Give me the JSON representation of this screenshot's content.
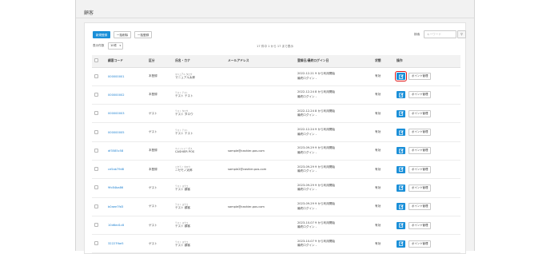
{
  "page": {
    "title": "顧客"
  },
  "toolbar": {
    "new_label": "新規登録",
    "bulk_delete_label": "一括削除",
    "bulk_register_label": "一括登録",
    "display_count_label": "表示件数",
    "display_count_value": "10件",
    "search_label": "検索",
    "search_placeholder": "キーワード"
  },
  "summary": "17 件中 1 から 17 まで表示",
  "table": {
    "headers": [
      "",
      "顧客コード",
      "区分",
      "氏名・カナ",
      "メールアドレス",
      "登録日/最終ログイン日",
      "状態",
      "操作"
    ],
    "edit_label": "編集",
    "points_label": "ポイント管理",
    "rows": [
      {
        "code": "000000001",
        "type": "本登録",
        "kana": "マニュアル タロウ",
        "name": "マニュアル太郎",
        "email": "",
        "login1": "2022-12-21 9 から利用開始",
        "login2": "最終ログイン -",
        "status": "有効"
      },
      {
        "code": "000000002",
        "type": "本登録",
        "kana": "テスト テスト",
        "name": "テスト テスト",
        "email": "",
        "login1": "2022-12-24 8 から利用開始",
        "login2": "最終ログイン -",
        "status": "有効"
      },
      {
        "code": "000000003",
        "type": "ゲスト",
        "kana": "テスト タロウ",
        "name": "テスト タロウ",
        "email": "",
        "login1": "2022-12-24 8 から利用開始",
        "login2": "最終ログイン -",
        "status": "有効"
      },
      {
        "code": "000000005",
        "type": "ゲスト",
        "kana": "テスト テスト",
        "name": "テスト テスト",
        "email": "",
        "login1": "2022-12-24 9 から利用開始",
        "login2": "最終ログイン -",
        "status": "有効"
      },
      {
        "code": "df3585c58",
        "type": "本登録",
        "kana": "キャッシャー ポス",
        "name": "CASHIER POS",
        "email": "sample@cashier-pos.com",
        "login1": "2023-09-29 9 から利用開始",
        "login2": "最終ログイン -",
        "status": "有効"
      },
      {
        "code": "ce5ab79d8",
        "type": "本登録",
        "kana": "ニセモノ タロウ",
        "name": "ニセモノ太郎",
        "email": "sample2@cashier-pos.com",
        "login1": "2023-09-29 9 から利用開始",
        "login2": "最終ログイン -",
        "status": "有効"
      },
      {
        "code": "9fc84ba86",
        "type": "ゲスト",
        "kana": "テスト ヨウコ",
        "name": "テスト 顧客",
        "email": "",
        "login1": "2023-09-29 9 から利用開始",
        "login2": "最終ログイン -",
        "status": "有効"
      },
      {
        "code": "b0aee7fd3",
        "type": "ゲスト",
        "kana": "テスト ヨウコ",
        "name": "テスト 顧客",
        "email": "sample@cashier-pos.com",
        "login1": "2023-09-29 9 から利用開始",
        "login2": "最終ログイン -",
        "status": "有効"
      },
      {
        "code": "10d6ed1c8",
        "type": "ゲスト",
        "kana": "テスト ヨウコ",
        "name": "テスト 顧客",
        "email": "",
        "login1": "2023-10-07 9 から利用開始",
        "login2": "最終ログイン -",
        "status": "有効"
      },
      {
        "code": "32227fbe5",
        "type": "ゲスト",
        "kana": "テスト ヨウコ",
        "name": "テスト 顧客",
        "email": "",
        "login1": "2023-10-07 9 から利用開始",
        "login2": "最終ログイン -",
        "status": "有効"
      }
    ]
  },
  "colors": {
    "accent": "#1a8fd8",
    "highlight": "#e01818",
    "link": "#1a7fd0"
  }
}
